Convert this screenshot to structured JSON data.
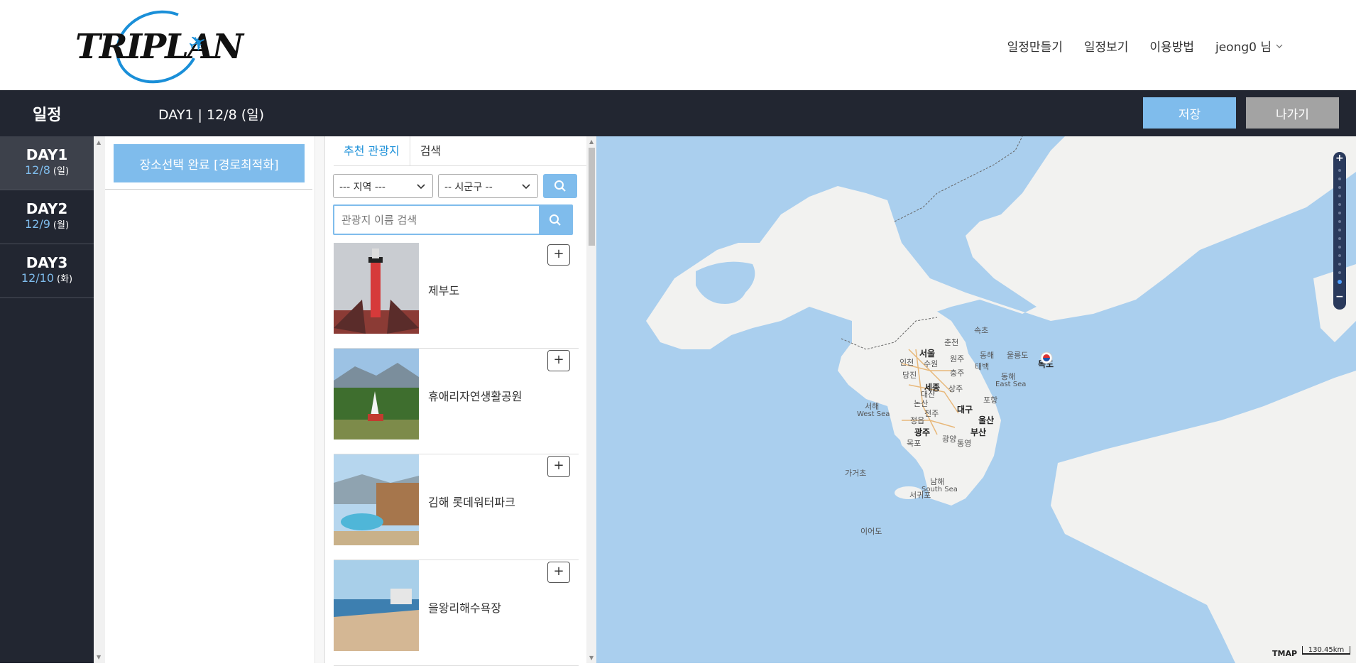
{
  "header": {
    "logo_text": "TRIPLAN",
    "nav": [
      "일정만들기",
      "일정보기",
      "이용방법"
    ],
    "user": "jeong0 님"
  },
  "topbar": {
    "section_title": "일정",
    "day_title": "DAY1 | 12/8 (일)",
    "save_label": "저장",
    "exit_label": "나가기"
  },
  "days": [
    {
      "name": "DAY1",
      "date": "12/8",
      "weekday": "(일)"
    },
    {
      "name": "DAY2",
      "date": "12/9",
      "weekday": "(월)"
    },
    {
      "name": "DAY3",
      "date": "12/10",
      "weekday": "(화)"
    }
  ],
  "selection": {
    "done_label": "장소선택 완료 [경로최적화]"
  },
  "places_panel": {
    "tabs": [
      "추천 관광지",
      "검색"
    ],
    "region_select": "--- 지역 ---",
    "district_select": "-- 시군구 --",
    "search_placeholder": "관광지 이름 검색",
    "items": [
      {
        "name": "제부도",
        "add": "+"
      },
      {
        "name": "휴애리자연생활공원",
        "add": "+"
      },
      {
        "name": "김해 롯데워터파크",
        "add": "+"
      },
      {
        "name": "을왕리해수욕장",
        "add": "+"
      }
    ]
  },
  "map": {
    "cities": [
      "서울",
      "인천",
      "수원",
      "원주",
      "춘천",
      "속초",
      "동해",
      "태백",
      "충주",
      "당진",
      "대산",
      "세종",
      "상주",
      "논산",
      "포항",
      "전주",
      "대구",
      "울산",
      "정읍",
      "광주",
      "광양",
      "부산",
      "목포",
      "통영",
      "서귀포",
      "독도",
      "울릉도",
      "가거초",
      "이어도"
    ],
    "seas": {
      "west_ko": "서해",
      "west_en": "West Sea",
      "east_ko": "동해",
      "east_en": "East Sea",
      "south_ko": "남해",
      "south_en": "South Sea"
    },
    "brand": "TMAP",
    "scale": "130.45km",
    "zoom_in": "+",
    "zoom_out": "−"
  },
  "colors": {
    "accent": "#7fbcec",
    "dark": "#222631",
    "sea": "#aacfee",
    "land": "#f2f2f0"
  }
}
